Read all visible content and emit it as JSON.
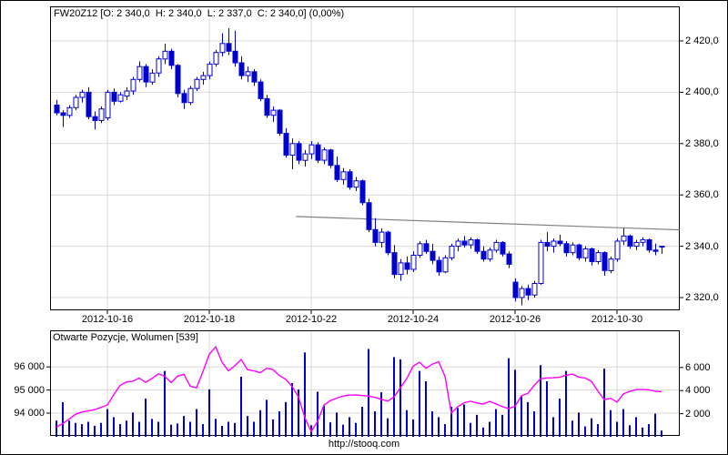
{
  "header": {
    "title": "FW20Z12 [O: 2 340,0  H: 2 340,0  L: 2 337,0  C: 2 340,0] (0,00%)"
  },
  "panel_lower": {
    "label": "Otwarte Pozycje, Wolumen [539]"
  },
  "watermark": "http://stooq.com",
  "axes": {
    "price_labels": [
      "2 420,0",
      "2 400,0",
      "2 380,0",
      "2 360,0",
      "2 340,0",
      "2 320,0"
    ],
    "date_labels": [
      "2012-10-16",
      "2012-10-18",
      "2012-10-22",
      "2012-10-24",
      "2012-10-26",
      "2012-10-30"
    ],
    "oi_labels": [
      "96 000",
      "95 000",
      "94 000"
    ],
    "volume_labels": [
      "6 000",
      "4 000",
      "2 000"
    ]
  },
  "colors": {
    "candle": "#0000cc",
    "open_interest_line": "#ff00ff",
    "trendline": "#808080",
    "grid": "#d9d9d9",
    "axis": "#000000",
    "background": "#ffffff"
  },
  "chart_data": {
    "type": "candlestick",
    "symbol": "FW20Z12",
    "timeframe": "hourly",
    "candles_per_day": 8,
    "date_tick_indices": [
      8,
      24,
      40,
      56,
      72,
      88
    ],
    "price_axis": {
      "ticks": [
        2420,
        2400,
        2380,
        2360,
        2340,
        2320
      ],
      "min": 2313,
      "max": 2428
    },
    "oi_axis": {
      "ticks": [
        96000,
        95000,
        94000
      ]
    },
    "volume_axis": {
      "ticks": [
        6000,
        4000,
        2000
      ]
    },
    "last_bar": {
      "open": "2 340,0",
      "high": "2 340,0",
      "low": "2 337,0",
      "close": "2 340,0",
      "change_pct": "0,00%",
      "volume": 539
    },
    "trendline": {
      "x1_candle": 37.6,
      "price1": 2351.6,
      "x2_candle": 97.8,
      "price2": 2346.4
    },
    "ohlc": [
      [
        2395,
        2397,
        2391,
        2392
      ],
      [
        2392,
        2393,
        2386.5,
        2391
      ],
      [
        2391,
        2395,
        2390,
        2394
      ],
      [
        2394,
        2399,
        2393,
        2398
      ],
      [
        2398,
        2401,
        2396,
        2400
      ],
      [
        2400,
        2402,
        2389.5,
        2390.5
      ],
      [
        2390.5,
        2392.5,
        2385.5,
        2389
      ],
      [
        2389,
        2394.5,
        2388,
        2393.5
      ],
      [
        2390,
        2401,
        2389,
        2400
      ],
      [
        2400,
        2401.5,
        2395,
        2396.5
      ],
      [
        2396.5,
        2400,
        2396,
        2399
      ],
      [
        2398.5,
        2402,
        2397,
        2400.5
      ],
      [
        2400.5,
        2406,
        2399,
        2405
      ],
      [
        2405,
        2412,
        2404,
        2410
      ],
      [
        2410,
        2411,
        2402,
        2404
      ],
      [
        2404,
        2409,
        2403,
        2407.5
      ],
      [
        2407.5,
        2414,
        2406,
        2413
      ],
      [
        2413,
        2419,
        2411,
        2416
      ],
      [
        2416,
        2417,
        2409,
        2410.5
      ],
      [
        2410.5,
        2411,
        2398,
        2399.5
      ],
      [
        2399.5,
        2401,
        2393.5,
        2396
      ],
      [
        2396,
        2402.5,
        2395,
        2401.5
      ],
      [
        2401.5,
        2406,
        2400.5,
        2405
      ],
      [
        2405,
        2408,
        2403,
        2406.5
      ],
      [
        2406.5,
        2412,
        2405,
        2411
      ],
      [
        2411,
        2416.5,
        2410,
        2415.5
      ],
      [
        2415.5,
        2423,
        2414,
        2419
      ],
      [
        2419,
        2425,
        2414.5,
        2416
      ],
      [
        2416,
        2424,
        2410,
        2411.5
      ],
      [
        2411.5,
        2414,
        2405,
        2406.5
      ],
      [
        2406.5,
        2410,
        2404,
        2408
      ],
      [
        2408,
        2409,
        2402.5,
        2404
      ],
      [
        2404,
        2405,
        2396.5,
        2397.5
      ],
      [
        2397.5,
        2399,
        2390,
        2391
      ],
      [
        2391,
        2394.5,
        2388.5,
        2393
      ],
      [
        2393,
        2393.5,
        2383,
        2384
      ],
      [
        2384,
        2386,
        2374.5,
        2375.5
      ],
      [
        2375.5,
        2382,
        2370,
        2380
      ],
      [
        2380,
        2381,
        2372,
        2373.5
      ],
      [
        2373.5,
        2377.5,
        2371,
        2376
      ],
      [
        2376,
        2381,
        2374,
        2379.5
      ],
      [
        2379.5,
        2380.5,
        2372.5,
        2373.5
      ],
      [
        2373.5,
        2378.5,
        2372,
        2377.5
      ],
      [
        2377.5,
        2378,
        2370.5,
        2371.5
      ],
      [
        2371.5,
        2375,
        2365,
        2366
      ],
      [
        2366,
        2370.5,
        2364,
        2369
      ],
      [
        2369,
        2370,
        2362,
        2363
      ],
      [
        2363,
        2367,
        2361.5,
        2365.5
      ],
      [
        2365.5,
        2366,
        2356,
        2357
      ],
      [
        2357,
        2358.5,
        2345.5,
        2346.5
      ],
      [
        2346.5,
        2351,
        2340,
        2341.5
      ],
      [
        2341.5,
        2347,
        2339.5,
        2345.5
      ],
      [
        2345.5,
        2346,
        2336.5,
        2337.5
      ],
      [
        2337.5,
        2340.5,
        2327.5,
        2329
      ],
      [
        2329,
        2335,
        2326.5,
        2333.5
      ],
      [
        2333.5,
        2336,
        2329,
        2331
      ],
      [
        2331,
        2338,
        2330,
        2336.5
      ],
      [
        2336.5,
        2342,
        2335.5,
        2341
      ],
      [
        2341,
        2342.5,
        2337,
        2338
      ],
      [
        2338,
        2341,
        2333,
        2334.5
      ],
      [
        2334.5,
        2336,
        2328.5,
        2330
      ],
      [
        2330,
        2336.5,
        2329.5,
        2335.5
      ],
      [
        2335.5,
        2341,
        2334.5,
        2340
      ],
      [
        2340,
        2343,
        2338,
        2342
      ],
      [
        2342,
        2344,
        2339.5,
        2340.5
      ],
      [
        2340.5,
        2343.5,
        2339,
        2342.5
      ],
      [
        2342.5,
        2343,
        2337,
        2338
      ],
      [
        2338,
        2340,
        2334,
        2335
      ],
      [
        2335,
        2339.5,
        2334,
        2338.5
      ],
      [
        2338.5,
        2342.5,
        2337.5,
        2341.5
      ],
      [
        2341.5,
        2342,
        2336,
        2337
      ],
      [
        2337,
        2338,
        2331.5,
        2333
      ],
      [
        2326,
        2327.5,
        2318.5,
        2320
      ],
      [
        2320,
        2324.5,
        2317,
        2323.5
      ],
      [
        2323.5,
        2325,
        2319,
        2321
      ],
      [
        2321,
        2326.5,
        2320,
        2325.5
      ],
      [
        2325.5,
        2342.5,
        2325,
        2341.5
      ],
      [
        2341.5,
        2345.5,
        2338,
        2340
      ],
      [
        2340,
        2343,
        2337.5,
        2342
      ],
      [
        2342,
        2344.5,
        2340,
        2341
      ],
      [
        2341,
        2342,
        2336,
        2337.5
      ],
      [
        2337.5,
        2341.5,
        2336.5,
        2340.5
      ],
      [
        2340.5,
        2341,
        2334.5,
        2335.5
      ],
      [
        2335.5,
        2340,
        2334,
        2339
      ],
      [
        2339,
        2339.5,
        2332.5,
        2334
      ],
      [
        2334,
        2338.5,
        2333,
        2337.5
      ],
      [
        2337.5,
        2338,
        2328.5,
        2330.5
      ],
      [
        2330.5,
        2336,
        2329.5,
        2335
      ],
      [
        2335,
        2343,
        2334,
        2342
      ],
      [
        2342,
        2347,
        2340.5,
        2344
      ],
      [
        2344,
        2344.5,
        2339,
        2340
      ],
      [
        2340,
        2342.5,
        2338.5,
        2341.5
      ],
      [
        2341.5,
        2343.5,
        2340,
        2342.5
      ],
      [
        2342.5,
        2343,
        2337.5,
        2338.5
      ],
      [
        2338.5,
        2341,
        2336.5,
        2338
      ],
      [
        2340,
        2340,
        2337,
        2340
      ]
    ],
    "volume": [
      1400,
      3000,
      1400,
      1200,
      1100,
      1300,
      950,
      1200,
      2400,
      1700,
      1100,
      1400,
      2100,
      1300,
      3300,
      1550,
      1300,
      5700,
      1050,
      1150,
      1800,
      1300,
      2400,
      1100,
      4100,
      1550,
      950,
      1300,
      1200,
      5200,
      1800,
      1300,
      2300,
      3200,
      1500,
      2200,
      3000,
      4650,
      4100,
      7300,
      1000,
      3900,
      2700,
      1250,
      2100,
      1050,
      1700,
      1200,
      2600,
      7600,
      2200,
      3850,
      1600,
      6900,
      6700,
      2300,
      1500,
      5700,
      4800,
      2200,
      1700,
      1100,
      2600,
      2500,
      2800,
      1200,
      1900,
      800,
      1300,
      2400,
      1900,
      6800,
      5800,
      3500,
      3000,
      2200,
      6200,
      4800,
      1700,
      3300,
      5700,
      1400,
      2100,
      900,
      1600,
      1100,
      5900,
      2300,
      1300,
      2400,
      1000,
      1700,
      800,
      1100,
      2000,
      539
    ],
    "open_interest": [
      93400,
      93550,
      93750,
      93950,
      94050,
      94100,
      94150,
      94250,
      94350,
      94800,
      95200,
      95350,
      95380,
      95520,
      95330,
      95500,
      95700,
      95600,
      95320,
      95600,
      95680,
      95170,
      95090,
      95800,
      96550,
      96870,
      96200,
      95830,
      96050,
      96320,
      95880,
      95830,
      95750,
      95940,
      95880,
      95630,
      95460,
      95150,
      94700,
      93800,
      93200,
      93650,
      94350,
      94540,
      94650,
      94740,
      94780,
      94790,
      94760,
      94740,
      94680,
      94600,
      94520,
      94700,
      95100,
      95500,
      96030,
      96200,
      95940,
      96120,
      96230,
      95590,
      94000,
      94280,
      94450,
      94510,
      94440,
      94390,
      94510,
      94400,
      94280,
      94200,
      94300,
      94750,
      94850,
      95200,
      95490,
      95520,
      95530,
      95550,
      95640,
      95690,
      95560,
      95520,
      95370,
      94960,
      94580,
      94640,
      94480,
      94830,
      94940,
      95020,
      95020,
      95010,
      94950,
      94930
    ]
  }
}
